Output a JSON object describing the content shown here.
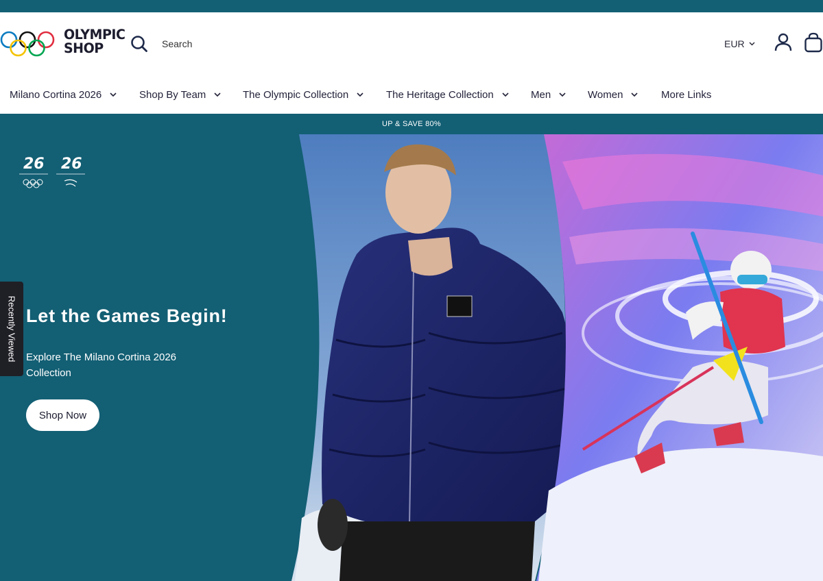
{
  "header": {
    "logo_line1": "OLYMPIC",
    "logo_line2": "SHOP",
    "search_label": "Search",
    "currency": "EUR"
  },
  "nav": {
    "items": [
      {
        "label": "Milano Cortina 2026",
        "dropdown": true
      },
      {
        "label": "Shop By Team",
        "dropdown": true
      },
      {
        "label": "The Olympic Collection",
        "dropdown": true
      },
      {
        "label": "The Heritage Collection",
        "dropdown": true
      },
      {
        "label": "Men",
        "dropdown": true
      },
      {
        "label": "Women",
        "dropdown": true
      },
      {
        "label": "More Links",
        "dropdown": false
      }
    ]
  },
  "promo": {
    "text": "UP & SAVE 80%"
  },
  "hero": {
    "title": "Let the Games Begin!",
    "subtitle": "Explore The Milano Cortina 2026 Collection",
    "cta": "Shop Now"
  },
  "sidebar": {
    "recently_viewed": "Recently Viewed"
  },
  "colors": {
    "brand_teal": "#135f74",
    "nav_text": "#22223a"
  }
}
